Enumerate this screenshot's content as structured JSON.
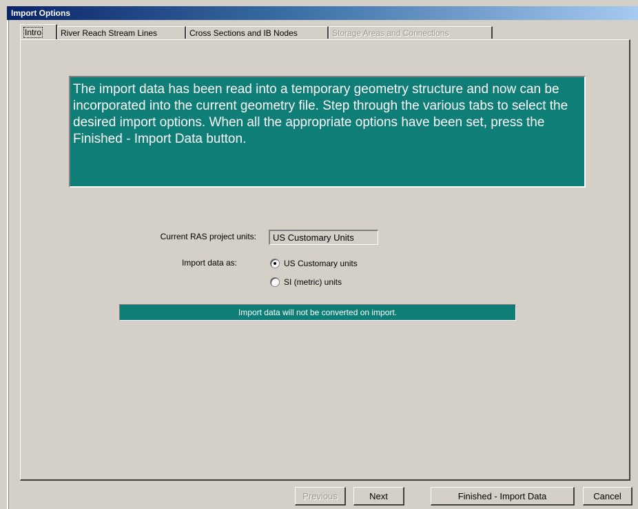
{
  "window": {
    "title": "Import Options"
  },
  "tabs": [
    {
      "label": "Intro",
      "active": true,
      "enabled": true
    },
    {
      "label": "River Reach Stream Lines",
      "active": false,
      "enabled": true
    },
    {
      "label": "Cross Sections and IB Nodes",
      "active": false,
      "enabled": true
    },
    {
      "label": "Storage Areas and Connections",
      "active": false,
      "enabled": false
    }
  ],
  "intro": {
    "message": "The import data has been read into a temporary geometry structure and now can be incorporated into the current geometry file.  Step through the various tabs to select the desired import options.  When all the appropriate options have been set, press the Finished - Import Data button."
  },
  "units": {
    "current_label": "Current RAS project units:",
    "current_value": "US Customary Units",
    "import_label": "Import data as:",
    "options": [
      {
        "label": "US Customary units",
        "checked": true
      },
      {
        "label": "SI (metric) units",
        "checked": false
      }
    ],
    "status": "Import data will not be converted on import."
  },
  "buttons": {
    "previous": "Previous",
    "next": "Next",
    "finish": "Finished - Import Data",
    "cancel": "Cancel"
  },
  "colors": {
    "accent": "#0e7e76",
    "face": "#d4d0c8",
    "title_dark": "#0a246a"
  }
}
